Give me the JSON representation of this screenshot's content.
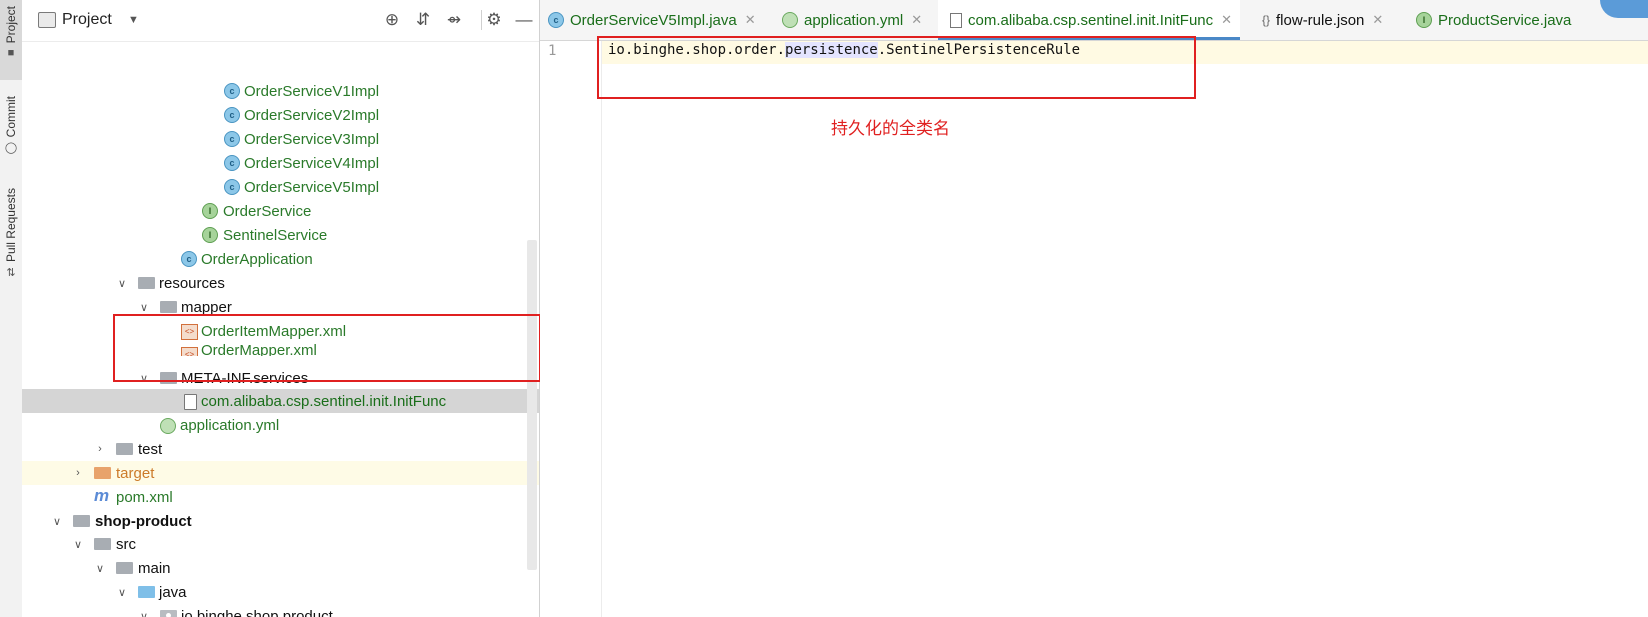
{
  "left_strip": {
    "tabs": [
      {
        "label": "Project",
        "icon": "folder-icon"
      },
      {
        "label": "Commit",
        "icon": "commit-icon"
      },
      {
        "label": "Pull Requests",
        "icon": "pull-request-icon"
      }
    ]
  },
  "project_panel": {
    "title": "Project",
    "toolbar": [
      "locate-icon",
      "expand-all-icon",
      "collapse-all-icon",
      "gear-icon",
      "minimize-icon"
    ],
    "tree": [
      {
        "label": "OrderServiceV1Impl",
        "icon": "class-icon",
        "level": 9
      },
      {
        "label": "OrderServiceV2Impl",
        "icon": "class-icon",
        "level": 9
      },
      {
        "label": "OrderServiceV3Impl",
        "icon": "class-icon",
        "level": 9
      },
      {
        "label": "OrderServiceV4Impl",
        "icon": "class-icon",
        "level": 9
      },
      {
        "label": "OrderServiceV5Impl",
        "icon": "class-icon",
        "level": 9
      },
      {
        "label": "OrderService",
        "icon": "interface-icon",
        "level": 8
      },
      {
        "label": "SentinelService",
        "icon": "interface-icon",
        "level": 8
      },
      {
        "label": "OrderApplication",
        "icon": "spring-class-icon",
        "level": 7
      },
      {
        "label": "resources",
        "icon": "resources-folder-icon",
        "level": 5,
        "expanded": true
      },
      {
        "label": "mapper",
        "icon": "folder-icon",
        "level": 6,
        "expanded": true
      },
      {
        "label": "OrderItemMapper.xml",
        "icon": "xml-file-icon",
        "level": 7
      },
      {
        "label": "OrderMapper.xml",
        "icon": "xml-file-icon",
        "level": 7
      },
      {
        "label": "META-INF.services",
        "icon": "folder-icon",
        "level": 6,
        "expanded": true
      },
      {
        "label": "com.alibaba.csp.sentinel.init.InitFunc",
        "icon": "text-file-icon",
        "level": 7,
        "selected": true
      },
      {
        "label": "application.yml",
        "icon": "yml-file-icon",
        "level": 6
      },
      {
        "label": "test",
        "icon": "folder-icon",
        "level": 4,
        "expanded": false
      },
      {
        "label": "target",
        "icon": "excluded-folder-icon",
        "level": 3,
        "expanded": false,
        "excluded": true
      },
      {
        "label": "pom.xml",
        "icon": "maven-icon",
        "level": 3
      },
      {
        "label": "shop-product",
        "icon": "module-folder-icon",
        "level": 2,
        "expanded": true,
        "bold": true
      },
      {
        "label": "src",
        "icon": "folder-icon",
        "level": 3,
        "expanded": true
      },
      {
        "label": "main",
        "icon": "folder-icon",
        "level": 4,
        "expanded": true
      },
      {
        "label": "java",
        "icon": "source-folder-icon",
        "level": 5,
        "expanded": true
      },
      {
        "label": "io.binghe.shop.product",
        "icon": "package-icon",
        "level": 6,
        "expanded": true
      }
    ]
  },
  "editor": {
    "tabs": [
      {
        "label": "OrderServiceV5Impl.java",
        "icon": "class-icon"
      },
      {
        "label": "application.yml",
        "icon": "yml-file-icon"
      },
      {
        "label": "com.alibaba.csp.sentinel.init.InitFunc",
        "icon": "text-file-icon",
        "active": true
      },
      {
        "label": "flow-rule.json",
        "icon": "json-file-icon"
      },
      {
        "label": "ProductService.java",
        "icon": "interface-icon"
      }
    ],
    "line_number": "1",
    "code": {
      "before": "io.binghe.shop.order.",
      "highlight": "persistence",
      "after": ".SentinelPersistenceRule"
    },
    "annotation": "持久化的全类名"
  },
  "colors": {
    "annotation_red": "#e02020",
    "tree_green": "#2a7a2a",
    "selection_gray": "#d5d5d5",
    "active_tab_underline": "#4a88c7"
  }
}
